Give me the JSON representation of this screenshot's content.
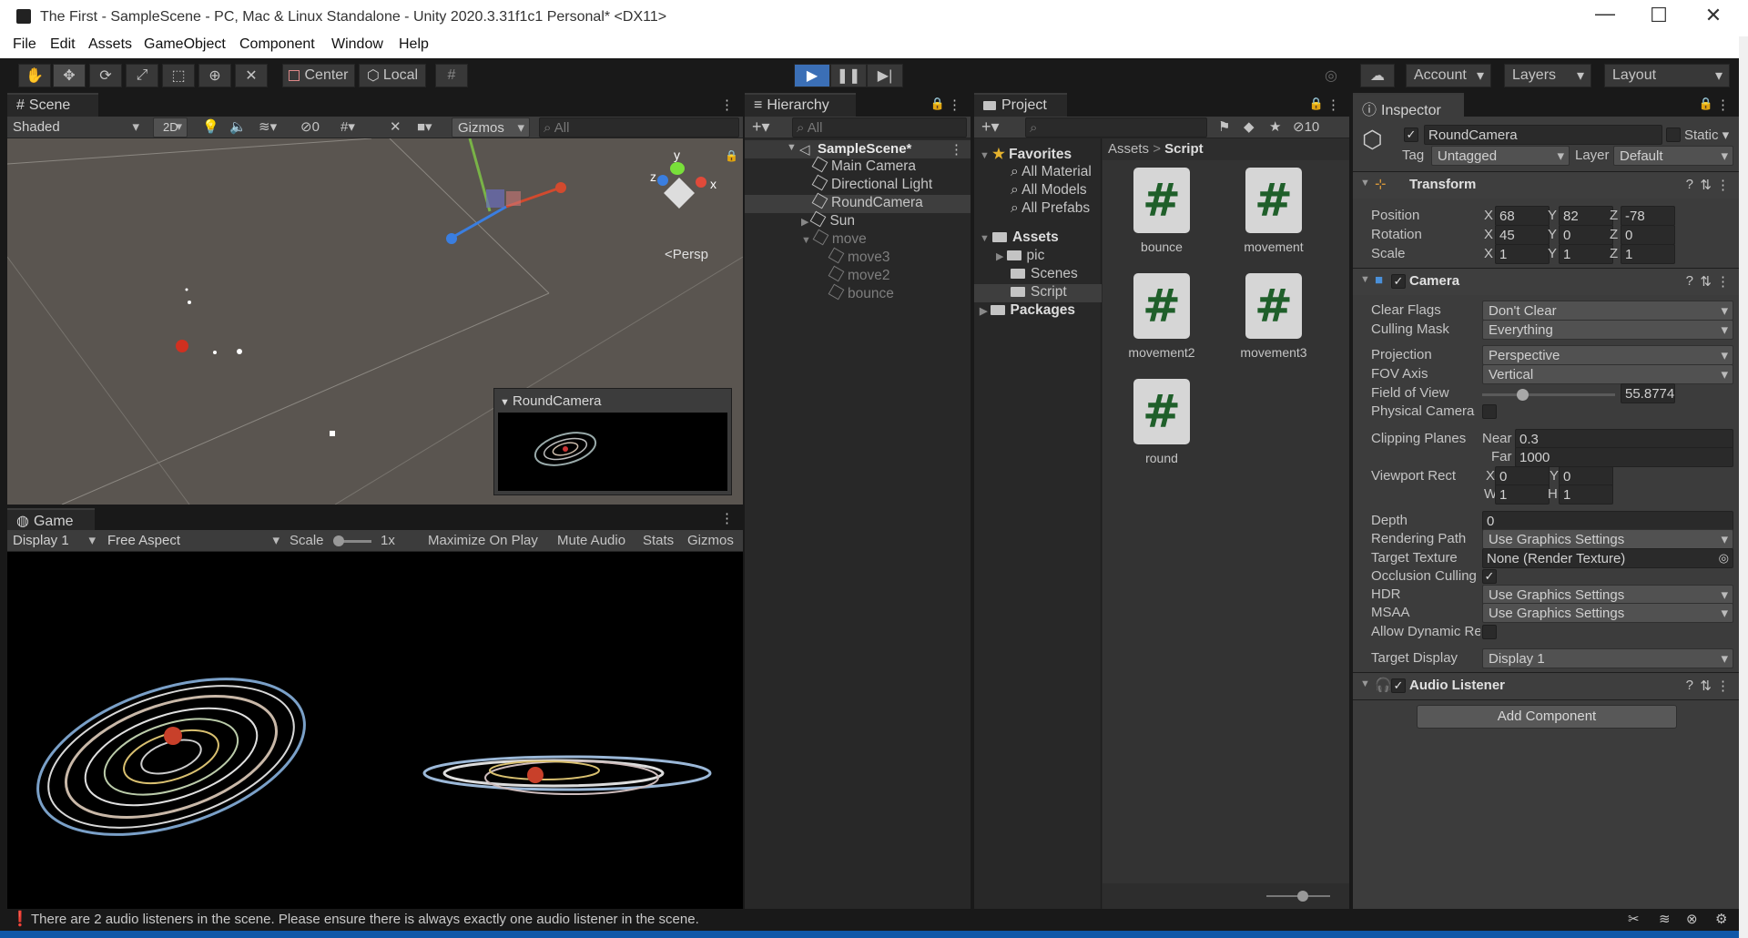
{
  "window": {
    "title": "The First - SampleScene - PC, Mac & Linux Standalone - Unity 2020.3.31f1c1 Personal* <DX11>",
    "controls": {
      "minimize": "—",
      "maximize": "☐",
      "close": "✕"
    }
  },
  "menu": [
    "File",
    "Edit",
    "Assets",
    "GameObject",
    "Component",
    "Window",
    "Help"
  ],
  "toolbar": {
    "pivot": "Center",
    "space": "Local",
    "account": "Account",
    "layers": "Layers",
    "layout": "Layout"
  },
  "scene": {
    "tab": "Scene",
    "shading": "Shaded",
    "mode2d": "2D",
    "hidden_count": "0",
    "gizmos": "Gizmos",
    "search_placeholder": "All",
    "persp": "<Persp",
    "gizmo_axes": {
      "x": "x",
      "y": "y",
      "z": "z"
    },
    "camera_preview_title": "RoundCamera"
  },
  "game": {
    "tab": "Game",
    "display": "Display 1",
    "aspect": "Free Aspect",
    "scale_label": "Scale",
    "scale_value": "1x",
    "maximize": "Maximize On Play",
    "mute": "Mute Audio",
    "stats": "Stats",
    "gizmos": "Gizmos"
  },
  "hierarchy": {
    "tab": "Hierarchy",
    "search_placeholder": "All",
    "root": "SampleScene*",
    "items": [
      {
        "label": "Main Camera",
        "depth": 1,
        "dim": false,
        "selected": false
      },
      {
        "label": "Directional Light",
        "depth": 1,
        "dim": false,
        "selected": false
      },
      {
        "label": "RoundCamera",
        "depth": 1,
        "dim": false,
        "selected": true
      },
      {
        "label": "Sun",
        "depth": 1,
        "dim": false,
        "selected": false
      },
      {
        "label": "move",
        "depth": 1,
        "dim": true,
        "selected": false
      },
      {
        "label": "move3",
        "depth": 2,
        "dim": true,
        "selected": false
      },
      {
        "label": "move2",
        "depth": 2,
        "dim": true,
        "selected": false
      },
      {
        "label": "bounce",
        "depth": 2,
        "dim": true,
        "selected": false
      }
    ]
  },
  "project": {
    "tab": "Project",
    "hidden_count": "10",
    "favorites": {
      "label": "Favorites",
      "items": [
        "All Material",
        "All Models",
        "All Prefabs"
      ]
    },
    "assets": {
      "label": "Assets",
      "items": [
        "pic",
        "Scenes",
        "Script"
      ]
    },
    "packages": "Packages",
    "breadcrumb": [
      "Assets",
      "Script"
    ],
    "files": [
      "bounce",
      "movement",
      "movement2",
      "movement3",
      "round"
    ]
  },
  "inspector": {
    "tab": "Inspector",
    "object_name": "RoundCamera",
    "static_label": "Static",
    "tag_label": "Tag",
    "tag": "Untagged",
    "layer_label": "Layer",
    "layer": "Default",
    "transform": {
      "title": "Transform",
      "position": {
        "label": "Position",
        "x": "68",
        "y": "82",
        "z": "-78"
      },
      "rotation": {
        "label": "Rotation",
        "x": "45",
        "y": "0",
        "z": "0"
      },
      "scale": {
        "label": "Scale",
        "x": "1",
        "y": "1",
        "z": "1"
      }
    },
    "camera": {
      "title": "Camera",
      "clear_flags_label": "Clear Flags",
      "clear_flags": "Don't Clear",
      "culling_mask_label": "Culling Mask",
      "culling_mask": "Everything",
      "projection_label": "Projection",
      "projection": "Perspective",
      "fov_axis_label": "FOV Axis",
      "fov_axis": "Vertical",
      "fov_label": "Field of View",
      "fov": "55.8774",
      "fov_fraction": 0.3,
      "physical_label": "Physical Camera",
      "clipping_label": "Clipping Planes",
      "near_label": "Near",
      "near": "0.3",
      "far_label": "Far",
      "far": "1000",
      "viewport_label": "Viewport Rect",
      "vx": "0",
      "vy": "0",
      "vw": "1",
      "vh": "1",
      "depth_label": "Depth",
      "depth": "0",
      "rendering_path_label": "Rendering Path",
      "rendering_path": "Use Graphics Settings",
      "target_texture_label": "Target Texture",
      "target_texture": "None (Render Texture)",
      "occlusion_label": "Occlusion Culling",
      "hdr_label": "HDR",
      "hdr": "Use Graphics Settings",
      "msaa_label": "MSAA",
      "msaa": "Use Graphics Settings",
      "dynamic_res_label": "Allow Dynamic Reso",
      "target_display_label": "Target Display",
      "target_display": "Display 1"
    },
    "audio_listener": {
      "title": "Audio Listener"
    },
    "add_component": "Add Component"
  },
  "status": {
    "message": "There are 2 audio listeners in the scene. Please ensure there is always exactly one audio listener in the scene."
  }
}
